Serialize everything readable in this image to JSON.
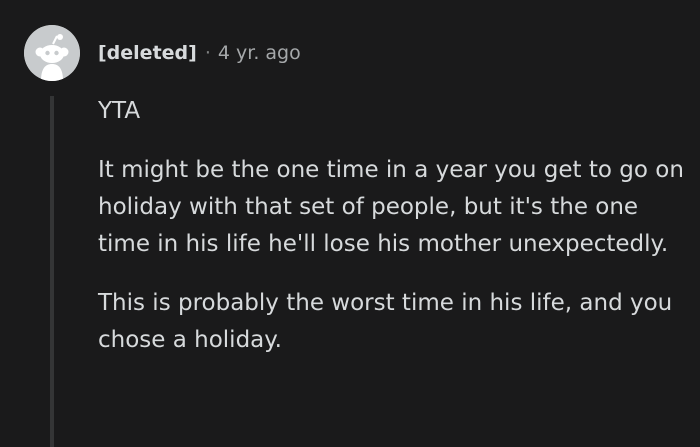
{
  "comment": {
    "author": "[deleted]",
    "separator": "·",
    "age": "4 yr. ago",
    "paragraphs": [
      "YTA",
      "It might be the one time in a year you get to go on holiday with that set of people, but it's the one time in his life he'll lose his mother unexpectedly.",
      "This is probably the worst time in his life, and you chose a holiday."
    ],
    "avatar_icon": "snoo-avatar-icon"
  },
  "colors": {
    "background": "#1a1a1b",
    "text": "#d7dadc",
    "meta_text": "#a5a8aa",
    "thread_line": "#343536",
    "avatar_bg": "#c8cbcd"
  }
}
